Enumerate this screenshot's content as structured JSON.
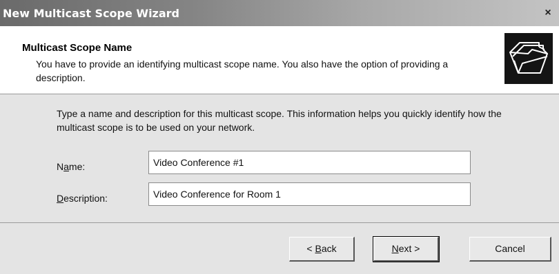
{
  "window": {
    "title": "New Multicast Scope Wizard",
    "close_glyph": "×"
  },
  "header": {
    "title": "Multicast Scope Name",
    "description": "You have to provide an identifying multicast scope name. You also have the option of providing a description.",
    "icon": "folders-icon"
  },
  "body": {
    "instructions": "Type a name and description for this multicast scope. This information helps you quickly identify how the multicast scope is to be used on your network.",
    "name_field": {
      "label_pre": "N",
      "label_acc": "a",
      "label_post": "me:",
      "value": "Video Conference #1"
    },
    "description_field": {
      "label_pre": "",
      "label_acc": "D",
      "label_post": "escription:",
      "value": "Video Conference for Room 1"
    }
  },
  "buttons": {
    "back": {
      "pre": "< ",
      "acc": "B",
      "post": "ack"
    },
    "next": {
      "pre": "",
      "acc": "N",
      "post": "ext >"
    },
    "cancel": "Cancel"
  }
}
